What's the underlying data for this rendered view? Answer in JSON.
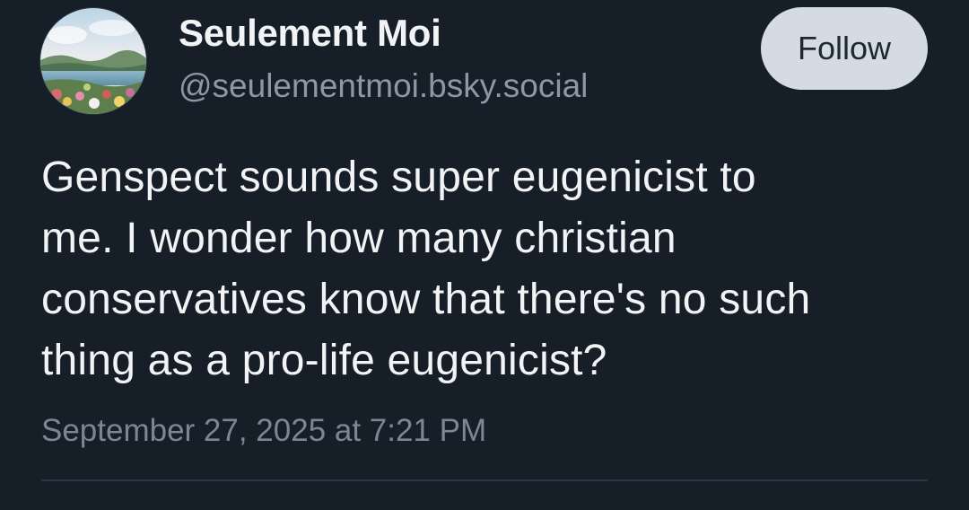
{
  "author": {
    "display_name": "Seulement Moi",
    "handle": "@seulementmoi.bsky.social",
    "avatar_icon": "landscape-painting-avatar"
  },
  "actions": {
    "follow_label": "Follow"
  },
  "post": {
    "text": "Genspect sounds super eugenicist to\nme. I wonder how many christian\nconservatives know that there's no such\nthing as a pro-life eugenicist?",
    "timestamp": "September 27, 2025 at 7:21 PM"
  },
  "colors": {
    "background": "#161e27",
    "text_primary": "#f1f3f5",
    "text_secondary": "#8b98a5",
    "follow_button_bg": "#d4dbe2"
  }
}
